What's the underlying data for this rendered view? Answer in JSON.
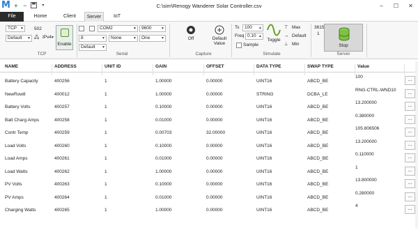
{
  "app": {
    "title": "C:\\sim\\Renogy Wanderer Solar Controller.csv",
    "logo": "M"
  },
  "quick_access": [
    "plus-icon",
    "minus-icon",
    "save-icon",
    "dropdown-icon"
  ],
  "window_controls": [
    "minimize",
    "maximize",
    "close"
  ],
  "menu": {
    "file": "File",
    "home": "Home",
    "client": "Client",
    "server": "Server",
    "iot": "IoT"
  },
  "ribbon": {
    "tcp": {
      "label": "TCP",
      "protocol": "TCP",
      "port": "502",
      "mode": "Default",
      "ip_version": "IPv4",
      "enable_label": "Enable"
    },
    "serial": {
      "label": "Serial",
      "port": "COM2",
      "baud": "9600",
      "data_bits": "8",
      "parity": "None",
      "stop_bits": "One",
      "mode": "Default"
    },
    "capture": {
      "label": "Capture",
      "off": "Off",
      "default_value_1": "Default",
      "default_value_2": "Value"
    },
    "simulate": {
      "label": "Simulate",
      "ts_label": "Ts",
      "ts_value": "100",
      "freq_label": "Freq",
      "freq_value": "0.10",
      "sample": "Sample",
      "toggle": "Toggle",
      "max": "Max",
      "default": "Default",
      "min": "Min"
    },
    "server": {
      "label": "Server",
      "port": "3615",
      "unit": "1",
      "stop": "Stop"
    }
  },
  "table": {
    "headers": [
      "NAME",
      "ADDRESS",
      "UNIT ID",
      "GAIN",
      "OFFSET",
      "DATA TYPE",
      "SWAP TYPE",
      "Value"
    ],
    "rows": [
      {
        "name": "Battery Capacity",
        "address": "400256",
        "unit": "1",
        "gain": "1.00000",
        "offset": "0.00000",
        "type": "UINT16",
        "swap": "ABCD_BE",
        "value": "100"
      },
      {
        "name": "NewRow8",
        "address": "400012",
        "unit": "1",
        "gain": "1.00000",
        "offset": "0.00000",
        "type": "STRING",
        "swap": "DCBA_LE",
        "value": "RNG-CTRL-WND10"
      },
      {
        "name": "Battery Volts",
        "address": "400257",
        "unit": "1",
        "gain": "0.10000",
        "offset": "0.00000",
        "type": "UINT16",
        "swap": "ABCD_BE",
        "value": "13.200000"
      },
      {
        "name": "Batt Charg Amps",
        "address": "400258",
        "unit": "1",
        "gain": "0.01000",
        "offset": "0.00000",
        "type": "UINT16",
        "swap": "ABCD_BE",
        "value": "0.380000"
      },
      {
        "name": "Contr Temp",
        "address": "400259",
        "unit": "1",
        "gain": "0.00703",
        "offset": "32.00000",
        "type": "UINT16",
        "swap": "ABCD_BE",
        "value": "105.806506"
      },
      {
        "name": "Load Volts",
        "address": "400260",
        "unit": "1",
        "gain": "0.10000",
        "offset": "0.00000",
        "type": "UINT16",
        "swap": "ABCD_BE",
        "value": "13.200000"
      },
      {
        "name": "Load Amps",
        "address": "400261",
        "unit": "1",
        "gain": "0.01000",
        "offset": "0.00000",
        "type": "UINT16",
        "swap": "ABCD_BE",
        "value": "0.110000"
      },
      {
        "name": "Load Watts",
        "address": "400262",
        "unit": "1",
        "gain": "1.00000",
        "offset": "0.00000",
        "type": "UINT16",
        "swap": "ABCD_BE",
        "value": "1"
      },
      {
        "name": "PV Volts",
        "address": "400263",
        "unit": "1",
        "gain": "0.10000",
        "offset": "0.00000",
        "type": "UINT16",
        "swap": "ABCD_BE",
        "value": "13.800000"
      },
      {
        "name": "PV Amps",
        "address": "400264",
        "unit": "1",
        "gain": "0.01000",
        "offset": "0.00000",
        "type": "UINT16",
        "swap": "ABCD_BE",
        "value": "0.280000"
      },
      {
        "name": "Charging Watts",
        "address": "400265",
        "unit": "1",
        "gain": "1.00000",
        "offset": "0.00000",
        "type": "UINT16",
        "swap": "ABCD_BE",
        "value": "4"
      }
    ],
    "more_button": "..."
  },
  "colors": {
    "logo": "#2a7fd4",
    "file_tab": "#2b2b2b",
    "stop_icon": "#7dc242"
  }
}
